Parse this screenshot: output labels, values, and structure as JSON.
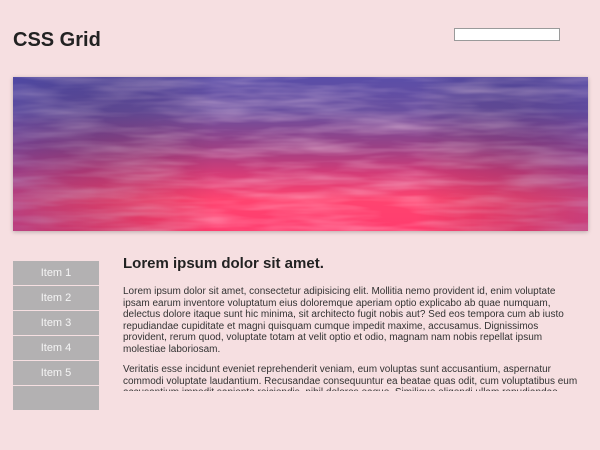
{
  "header": {
    "title": "CSS Grid",
    "search": {
      "value": "",
      "placeholder": ""
    }
  },
  "hero": {
    "image": "sunset-sky-image",
    "colors": {
      "top": "#5b4ea6",
      "middle": "#b23c7a",
      "bottom": "#ff3d6f"
    }
  },
  "sidebar": {
    "items": [
      {
        "label": "Item 1"
      },
      {
        "label": "Item 2"
      },
      {
        "label": "Item 3"
      },
      {
        "label": "Item 4"
      },
      {
        "label": "Item 5"
      }
    ]
  },
  "main": {
    "title": "Lorem ipsum dolor sit amet.",
    "paragraphs": [
      "Lorem ipsum dolor sit amet, consectetur adipisicing elit. Mollitia nemo provident id, enim voluptate ipsam earum inventore voluptatum eius doloremque aperiam optio explicabo ab quae numquam, delectus dolore itaque sunt hic minima, sit architecto fugit nobis aut? Sed eos tempora cum ab iusto repudiandae cupiditate et magni quisquam cumque impedit maxime, accusamus. Dignissimos provident, rerum quod, voluptate totam at velit optio et odio, magnam nam nobis repellat ipsum molestiae laboriosam.",
      "Veritatis esse incidunt eveniet reprehenderit veniam, eum voluptas sunt accusantium, aspernatur commodi voluptate laudantium. Recusandae consequuntur ea beatae quas odit, cum voluptatibus eum accusantium impedit sapiente reiciendis, nihil dolores eaque. Similique eligendi ullam repudiandae facilis"
    ]
  },
  "theme": {
    "background": "#f6dfe1",
    "sidebar_item_bg": "#b3b1b2",
    "sidebar_item_text": "#f5f5f5"
  }
}
